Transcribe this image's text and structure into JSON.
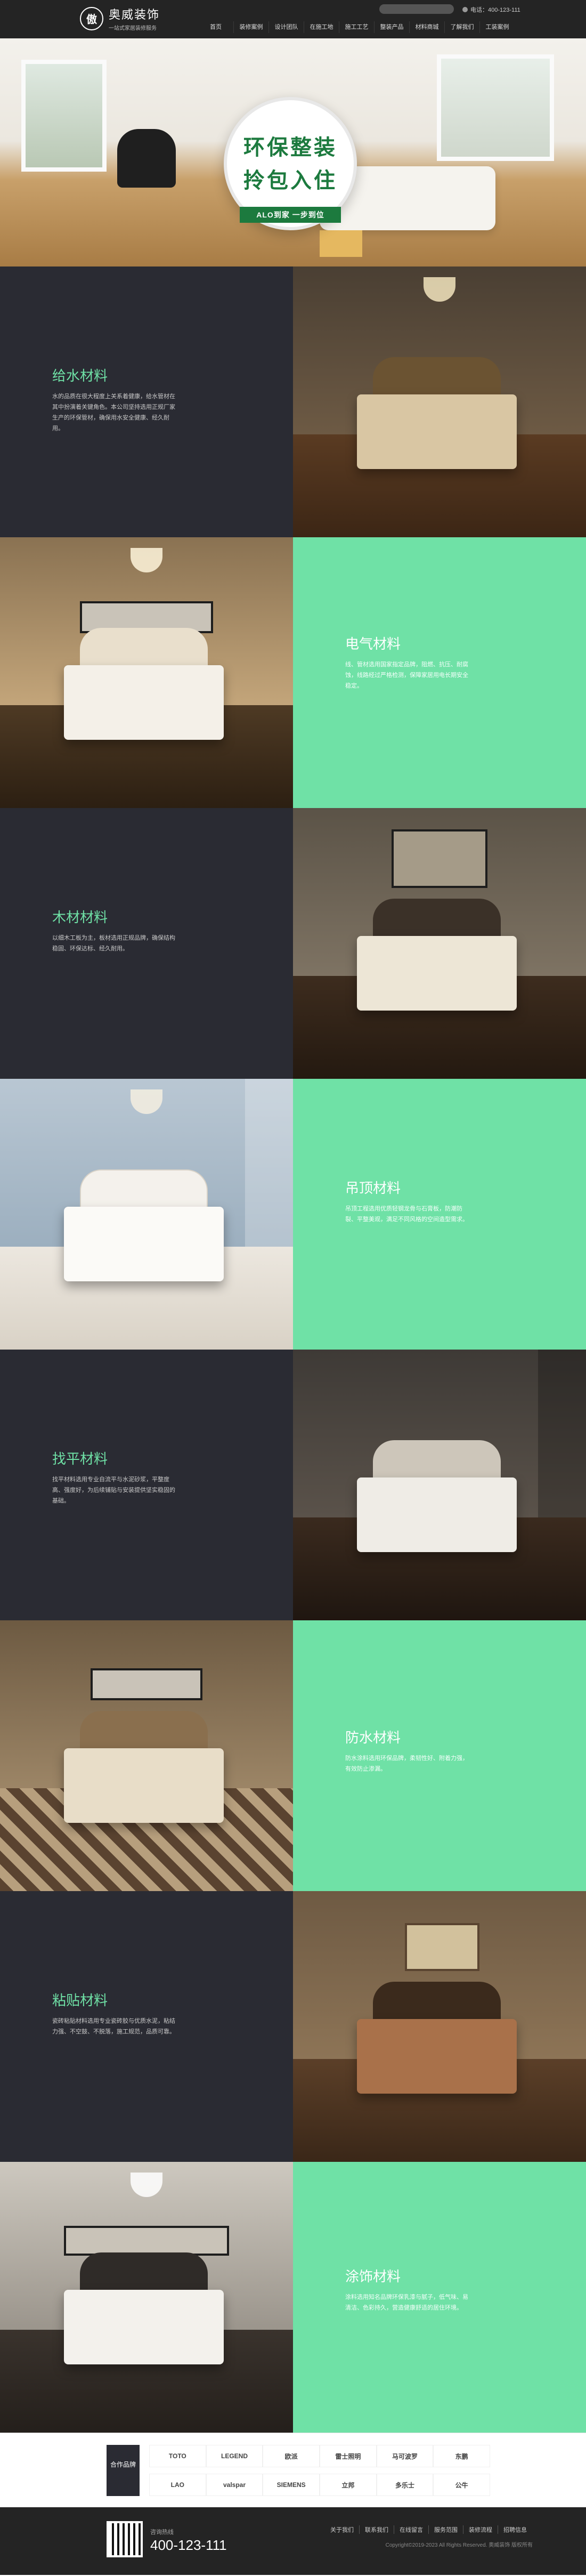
{
  "header": {
    "logo_mark": "傲",
    "logo_name": "奥威装饰",
    "logo_sub": "一站式家居装修服务",
    "search_placeholder": "",
    "phone": "电话：400-123-111",
    "nav": [
      "首页",
      "装修案例",
      "设计团队",
      "在施工地",
      "施工工艺",
      "整装产品",
      "材料商城",
      "了解我们",
      "工装案例"
    ]
  },
  "hero": {
    "badge_line1": "环保整装",
    "badge_line2": "拎包入住",
    "badge_ribbon": "ALO到家 一步到位"
  },
  "materials": [
    {
      "title": "给水材料",
      "desc": "水的品质在很大程度上关系着健康，给水管材在其中扮演着关键角色。本公司坚持选用正规厂家生产的环保管材，确保用水安全健康、经久耐用。",
      "theme": "dark"
    },
    {
      "title": "电气材料",
      "desc": "线、管材选用国家指定品牌，阻燃、抗压、耐腐蚀，线路经过严格检测，保障家居用电长期安全稳定。",
      "theme": "green"
    },
    {
      "title": "木材材料",
      "desc": "以细木工板为主，板材选用正规品牌，确保结构稳固、环保达标、经久耐用。",
      "theme": "dark"
    },
    {
      "title": "吊顶材料",
      "desc": "吊顶工程选用优质轻钢龙骨与石膏板，防潮防裂、平整美观，满足不同风格的空间造型需求。",
      "theme": "green"
    },
    {
      "title": "找平材料",
      "desc": "找平材料选用专业自流平与水泥砂浆，平整度高、强度好，为后续铺贴与安装提供坚实稳固的基础。",
      "theme": "dark"
    },
    {
      "title": "防水材料",
      "desc": "防水涂料选用环保品牌，柔韧性好、附着力强，有效防止渗漏。",
      "theme": "green"
    },
    {
      "title": "粘贴材料",
      "desc": "瓷砖粘贴材料选用专业瓷砖胶与优质水泥，粘结力强、不空鼓、不脱落，施工规范，品质可靠。",
      "theme": "dark"
    },
    {
      "title": "涂饰材料",
      "desc": "涂料选用知名品牌环保乳漆与腻子，低气味、易清洁、色彩持久，营造健康舒适的居住环境。",
      "theme": "green"
    }
  ],
  "partners": {
    "label": "合作品牌",
    "brands": [
      "TOTO",
      "LEGEND",
      "欧派",
      "雷士照明",
      "马可波罗",
      "东鹏",
      "LAO",
      "valspar",
      "SIEMENS",
      "立邦",
      "多乐士",
      "公牛"
    ]
  },
  "footer": {
    "hotline_label": "咨询热线",
    "hotline": "400-123-111",
    "links": [
      "关于我们",
      "联系我们",
      "在线留言",
      "服务范围",
      "装修流程",
      "招聘信息"
    ],
    "copyright": "Copyright©2019-2023 All Rights Reserved.  奥威装饰  版权所有"
  }
}
